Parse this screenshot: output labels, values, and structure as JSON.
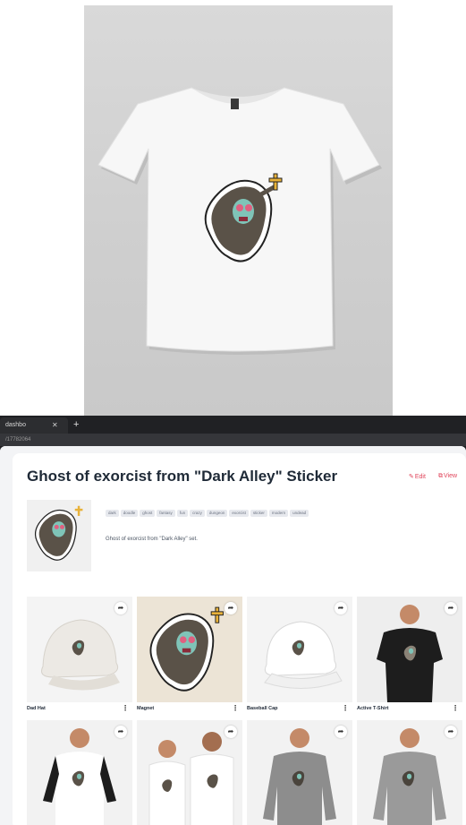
{
  "browser": {
    "tab_title": "dashbo",
    "tab_close": "✕",
    "new_tab": "+",
    "url": "/17782064"
  },
  "product": {
    "title": "Ghost of exorcist from \"Dark Alley\" Sticker",
    "edit_label": "Edit",
    "view_label": "View",
    "tags": [
      "dark",
      "doodle",
      "ghost",
      "fantasy",
      "fun",
      "crazy",
      "dungeon",
      "exorcist",
      "sticker",
      "modern",
      "undead"
    ],
    "description": "Ghost of exorcist from \"Dark Alley\" set."
  },
  "products": [
    {
      "label": "Dad Hat"
    },
    {
      "label": "Magnet"
    },
    {
      "label": "Baseball Cap"
    },
    {
      "label": "Active T-Shirt"
    },
    {
      "label": ""
    },
    {
      "label": ""
    },
    {
      "label": ""
    },
    {
      "label": ""
    }
  ],
  "icons": {
    "share": "share-icon",
    "menu": "more-vertical-icon",
    "edit": "pencil-icon",
    "view": "external-link-icon"
  },
  "colors": {
    "accent": "#e0445a",
    "title": "#1f2a37",
    "browser_chrome": "#1e1f22"
  }
}
